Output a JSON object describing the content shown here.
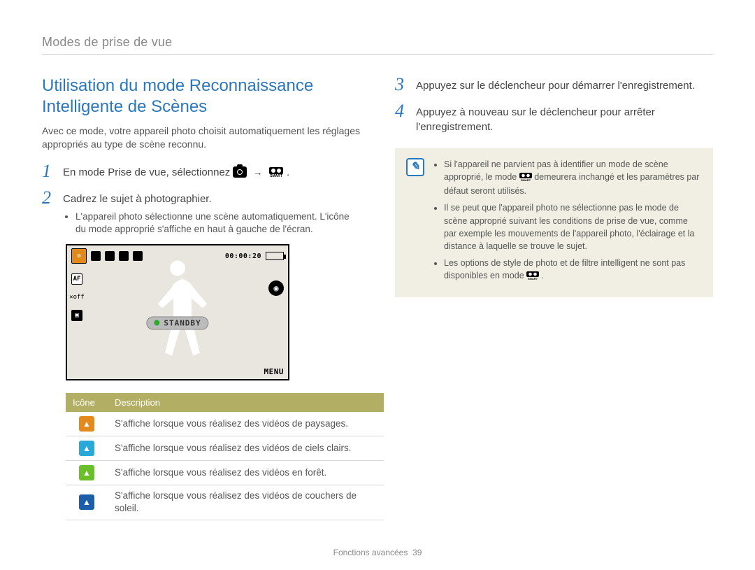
{
  "breadcrumb": "Modes de prise de vue",
  "section_title": "Utilisation du mode Reconnaissance Intelligente de Scènes",
  "intro": "Avec ce mode, votre appareil photo choisit automatiquement les réglages appropriés au type de scène reconnu.",
  "steps": {
    "s1": "En mode Prise de vue, sélectionnez",
    "s1_trail": ".",
    "s2": "Cadrez le sujet à photographier.",
    "s2_bullet": "L'appareil photo sélectionne une scène automatiquement. L'icône du mode approprié s'affiche en haut à gauche de l'écran.",
    "s3": "Appuyez sur le déclencheur pour démarrer l'enregistrement.",
    "s4": "Appuyez à nouveau sur le déclencheur pour arrêter l'enregistrement."
  },
  "lcd": {
    "timecode": "00:00:20",
    "standby": "STANDBY",
    "menu": "MENU",
    "smart_label": "SMART"
  },
  "table": {
    "head_icon": "Icône",
    "head_desc": "Description",
    "rows": [
      {
        "color": "orange",
        "desc": "S'affiche lorsque vous réalisez des vidéos de paysages."
      },
      {
        "color": "blue",
        "desc": "S'affiche lorsque vous réalisez des vidéos de ciels clairs."
      },
      {
        "color": "green",
        "desc": "S'affiche lorsque vous réalisez des vidéos en forêt."
      },
      {
        "color": "dblue",
        "desc": "S'affiche lorsque vous réalisez des vidéos de couchers de soleil."
      }
    ]
  },
  "note": {
    "items": [
      {
        "pre": "Si l'appareil ne parvient pas à identifier un mode de scène approprié, le mode ",
        "post": " demeurera inchangé et les paramètres par défaut seront utilisés."
      },
      {
        "pre": "Il se peut que l'appareil photo ne sélectionne pas le mode de scène approprié suivant les conditions de prise de vue, comme par exemple les mouvements de l'appareil photo, l'éclairage et la distance à laquelle se trouve le sujet.",
        "post": ""
      },
      {
        "pre": "Les options de style de photo et de filtre intelligent ne sont pas disponibles en mode ",
        "post": "."
      }
    ]
  },
  "footer": {
    "section": "Fonctions avancées",
    "page": "39"
  }
}
